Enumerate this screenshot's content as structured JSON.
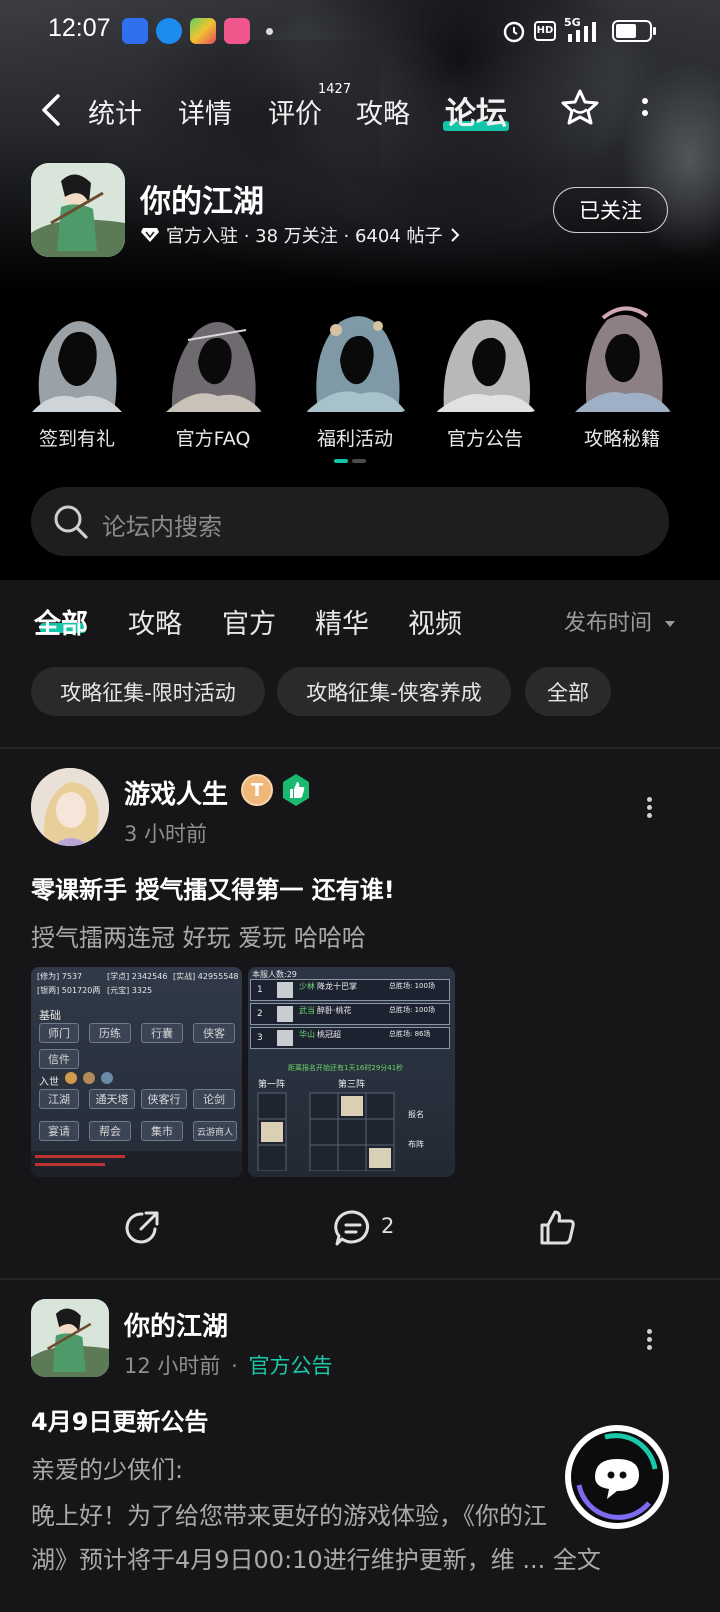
{
  "status_bar": {
    "time": "12:07",
    "network": "5G",
    "hd": "HD"
  },
  "nav": {
    "tabs": [
      "统计",
      "详情",
      "评价",
      "攻略",
      "论坛"
    ],
    "active_tab": "论坛",
    "review_badge": "1427"
  },
  "game": {
    "title": "你的江湖",
    "meta": "官方入驻 · 38 万关注 · 6404 帖子",
    "follow_label": "已关注"
  },
  "shortcuts": [
    {
      "label": "签到有礼"
    },
    {
      "label": "官方FAQ"
    },
    {
      "label": "福利活动"
    },
    {
      "label": "官方公告"
    },
    {
      "label": "攻略秘籍"
    }
  ],
  "search": {
    "placeholder": "论坛内搜索"
  },
  "feed_tabs": [
    "全部",
    "攻略",
    "官方",
    "精华",
    "视频"
  ],
  "sort_label": "发布时间",
  "chips": [
    "攻略征集-限时活动",
    "攻略征集-侠客养成",
    "全部"
  ],
  "posts": [
    {
      "author": "游戏人生",
      "level_badge": "T",
      "time": "3 小时前",
      "title": "零课新手 授气擂又得第一 还有谁!",
      "body": "授气擂两连冠 好玩 爱玩 哈哈哈",
      "comments": "2",
      "image1": {
        "stats": [
          "[修为] 7537",
          "[学点] 2342546",
          "[实战] 42955548",
          "[银两] 501720两",
          "[元宝] 3325"
        ],
        "section": "基础",
        "buttons": [
          "师门",
          "历练",
          "行囊",
          "侠客",
          "信件",
          "江湖",
          "通天塔",
          "侠客行",
          "论剑",
          "宴请",
          "帮会",
          "集市",
          "云游商人"
        ],
        "row_label": "入世"
      },
      "image2": {
        "header": "本服人数:29",
        "ranks": [
          {
            "rank": "1",
            "name": "降龙十巴掌",
            "sect": "少林",
            "wins": "总胜场: 100场"
          },
          {
            "rank": "2",
            "name": "醉卧·桃花",
            "sect": "武当",
            "wins": "总胜场: 100场"
          },
          {
            "rank": "3",
            "name": "桃冠超",
            "sect": "华山",
            "wins": "总胜场: 86场"
          }
        ],
        "countdown": "距离报名开始还有1天16时29分41秒",
        "formation1": "第一阵",
        "formation3": "第三阵",
        "btn_signup": "报名",
        "btn_arrange": "布阵"
      }
    },
    {
      "author": "你的江湖",
      "time": "12 小时前",
      "category": "官方公告",
      "title": "4月9日更新公告",
      "line1": "亲爱的少侠们:",
      "line2": "晚上好！为了给您带来更好的游戏体验，《你的江",
      "line3": "湖》预计将于4月9日00:10进行维护更新，维 ... 全文"
    }
  ],
  "colors": {
    "accent": "#14c4a8",
    "background": "#000000",
    "feed_background": "#161618"
  }
}
